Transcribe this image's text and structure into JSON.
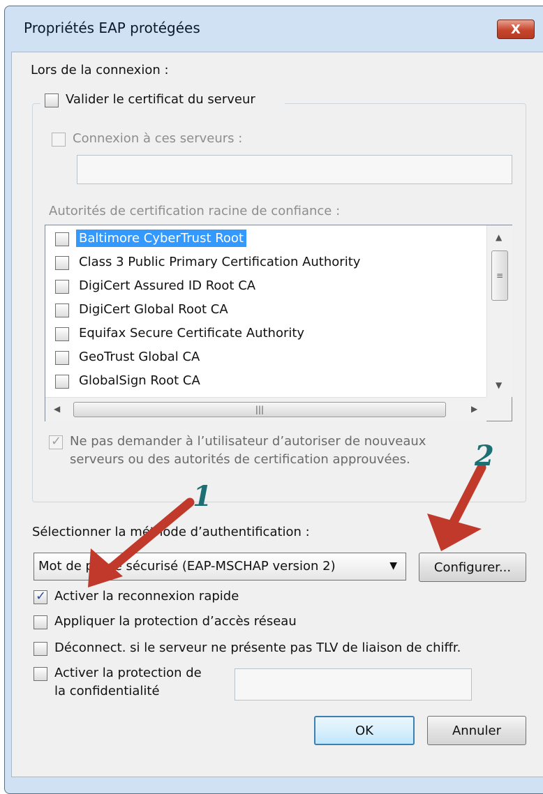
{
  "window": {
    "title": "Propriétés EAP protégées",
    "close_label": "X"
  },
  "connection": {
    "heading": "Lors de la connexion :",
    "validate_cert": {
      "label": "Valider le certificat du serveur",
      "checked": false
    },
    "connect_servers": {
      "label": "Connexion à ces serveurs :",
      "checked": false,
      "value": ""
    },
    "root_ca_label": "Autorités de certification racine de confiance :",
    "certificates": [
      {
        "label": "Baltimore CyberTrust Root",
        "checked": false,
        "selected": true
      },
      {
        "label": "Class 3 Public Primary Certification Authority",
        "checked": false
      },
      {
        "label": "DigiCert Assured ID Root CA",
        "checked": false
      },
      {
        "label": "DigiCert Global Root CA",
        "checked": false
      },
      {
        "label": "Equifax Secure Certificate Authority",
        "checked": false
      },
      {
        "label": "GeoTrust Global CA",
        "checked": false
      },
      {
        "label": "GlobalSign Root CA",
        "checked": false
      }
    ],
    "no_prompt": {
      "line1": "Ne pas demander à l’utilisateur d’autoriser de nouveaux",
      "line2": "serveurs ou des autorités de certification approuvées.",
      "checked": true
    }
  },
  "auth": {
    "label": "Sélectionner la méthode d’authentification :",
    "selected_method": "Mot de passe sécurisé (EAP-MSCHAP version 2)",
    "configure_label": "Configurer..."
  },
  "options": [
    {
      "label": "Activer la reconnexion rapide",
      "checked": true
    },
    {
      "label": "Appliquer la protection d’accès réseau",
      "checked": false
    },
    {
      "label": "Déconnect. si le serveur ne présente pas TLV de liaison de chiffr.",
      "checked": false
    }
  ],
  "privacy": {
    "line1": "Activer la protection de",
    "line2": "la confidentialité",
    "checked": false,
    "value": ""
  },
  "buttons": {
    "ok": "OK",
    "cancel": "Annuler"
  },
  "annotations": {
    "marker1": "1",
    "marker2": "2",
    "arrow_color": "#c0392b",
    "marker_color": "#1d6f74"
  }
}
